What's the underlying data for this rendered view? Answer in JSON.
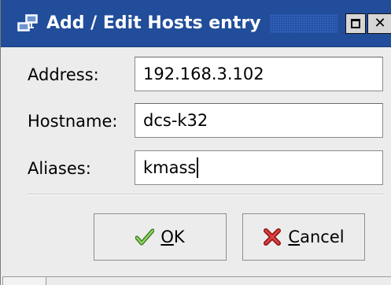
{
  "window": {
    "title": "Add / Edit Hosts entry",
    "title_bar_color": "#214d9a",
    "icons": {
      "app": "network-hosts-icon",
      "maximize": "maximize-icon",
      "close": "close-icon"
    }
  },
  "form": {
    "address": {
      "label": "Address:",
      "value": "192.168.3.102"
    },
    "hostname": {
      "label": "Hostname:",
      "value": "dcs-k32"
    },
    "aliases": {
      "label": "Aliases:",
      "value": "kmass"
    }
  },
  "buttons": {
    "ok": {
      "mnemonic": "O",
      "rest": "K",
      "icon": "checkmark-icon",
      "icon_color": "#3a9a2a"
    },
    "cancel": {
      "mnemonic": "C",
      "rest": "ancel",
      "icon": "red-x-icon",
      "icon_color": "#cc2222"
    }
  }
}
